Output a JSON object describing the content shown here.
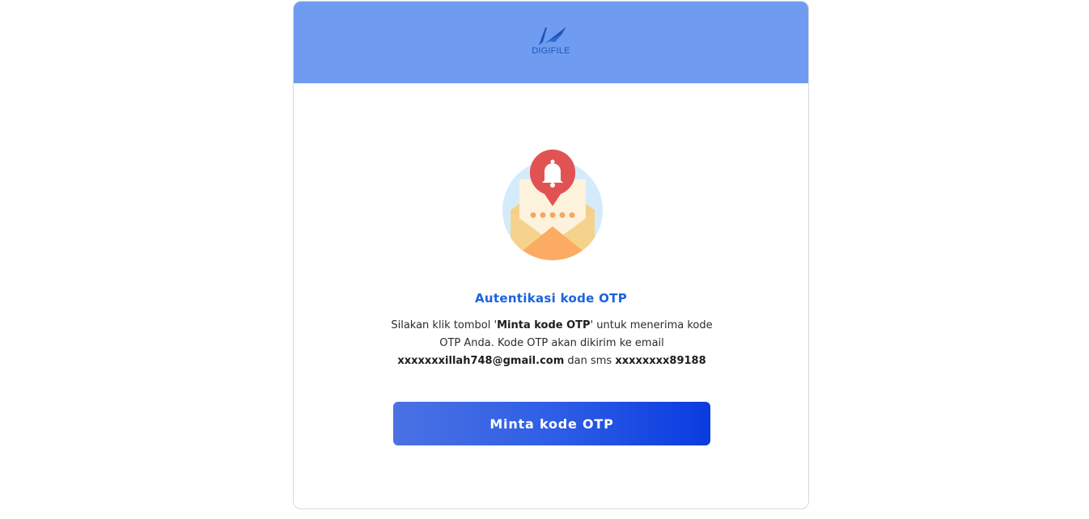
{
  "brand": {
    "name": "DIGIFILE",
    "header_color": "#6f9cf1",
    "accent_color": "#1b63e0"
  },
  "auth": {
    "title": "Autentikasi kode OTP",
    "desc_part1": "Silakan klik tombol '",
    "desc_bold_button": "Minta kode OTP",
    "desc_part2": "' untuk menerima kode OTP Anda. Kode OTP akan dikirim ke email ",
    "email": "xxxxxxxillah748@gmail.com",
    "desc_part3": " dan sms ",
    "phone": "xxxxxxxx89188",
    "button_label": "Minta kode OTP"
  },
  "icons": {
    "logo": "digifile-logo-icon",
    "illustration": "envelope-notification-bell-icon"
  }
}
